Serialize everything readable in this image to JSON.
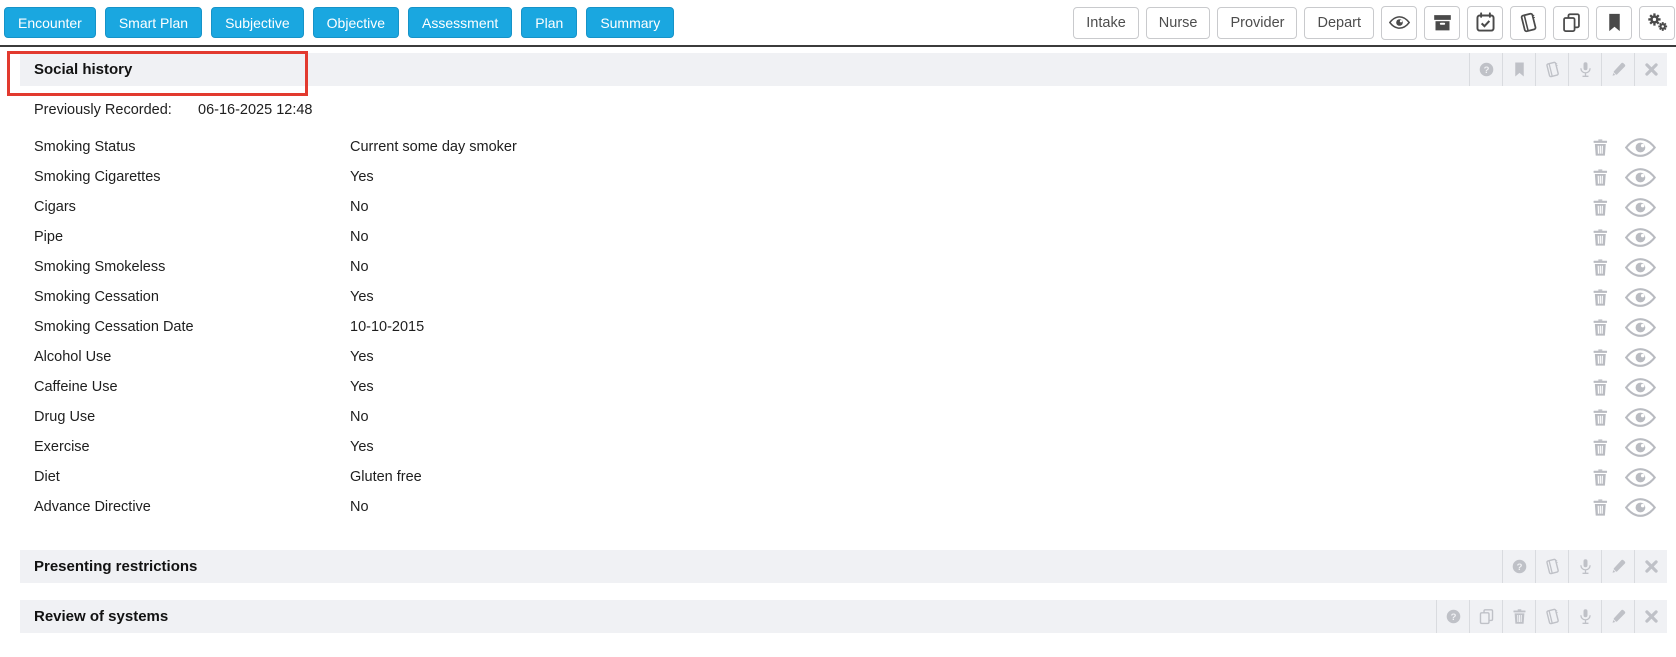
{
  "colors": {
    "accent_blue": "#1aa7e0",
    "annotation_red": "#e23a2f",
    "section_bar_gray": "#f0f1f4"
  },
  "toolbar": {
    "nav_buttons": [
      "Encounter",
      "Smart Plan",
      "Subjective",
      "Objective",
      "Assessment",
      "Plan",
      "Summary"
    ],
    "stage_buttons": [
      "Intake",
      "Nurse",
      "Provider",
      "Depart"
    ],
    "icon_buttons": [
      "eye",
      "archive",
      "calendar-check",
      "book",
      "copy",
      "bookmark",
      "gears"
    ]
  },
  "sections": {
    "social_history": {
      "title": "Social history",
      "header_icons": [
        "help",
        "bookmark",
        "book",
        "microphone",
        "pencil",
        "close"
      ],
      "previously_recorded_label": "Previously Recorded:",
      "previously_recorded_value": "06-16-2025 12:48",
      "row_icons": [
        "trash",
        "eye"
      ],
      "rows": [
        {
          "label": "Smoking Status",
          "value": "Current some day smoker"
        },
        {
          "label": "Smoking Cigarettes",
          "value": "Yes"
        },
        {
          "label": "Cigars",
          "value": "No"
        },
        {
          "label": "Pipe",
          "value": "No"
        },
        {
          "label": "Smoking Smokeless",
          "value": "No"
        },
        {
          "label": "Smoking Cessation",
          "value": "Yes"
        },
        {
          "label": "Smoking Cessation Date",
          "value": "10-10-2015"
        },
        {
          "label": "Alcohol Use",
          "value": "Yes"
        },
        {
          "label": "Caffeine Use",
          "value": "Yes"
        },
        {
          "label": "Drug Use",
          "value": "No"
        },
        {
          "label": "Exercise",
          "value": "Yes"
        },
        {
          "label": "Diet",
          "value": "Gluten free"
        },
        {
          "label": "Advance Directive",
          "value": "No"
        }
      ]
    },
    "presenting_restrictions": {
      "title": "Presenting restrictions",
      "header_icons": [
        "help",
        "book",
        "microphone",
        "pencil",
        "close"
      ]
    },
    "review_of_systems": {
      "title": "Review of systems",
      "header_icons": [
        "help",
        "copy",
        "trash",
        "book",
        "microphone",
        "pencil",
        "close"
      ]
    }
  }
}
